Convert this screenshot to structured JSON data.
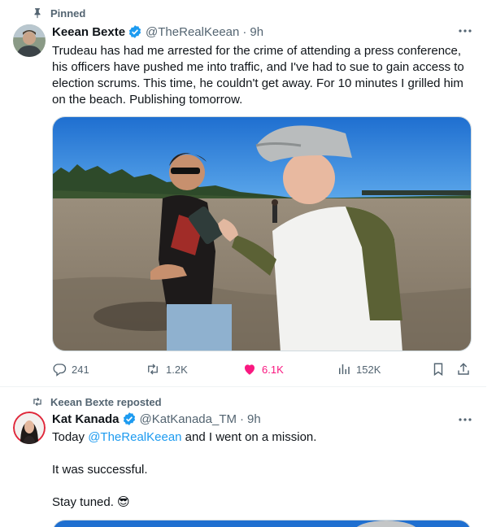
{
  "tweet1": {
    "social_context": "Pinned",
    "author_name": "Keean Bexte",
    "author_handle": "@TheRealKeean",
    "separator": "·",
    "time": "9h",
    "text": "Trudeau has had me arrested for the crime of attending a press conference, his officers have pushed me into traffic, and I've had to sue to gain access to election scrums. This time, he couldn't get away. For 10 minutes I grilled him on the beach. Publishing tomorrow.",
    "metrics": {
      "replies": "241",
      "reposts": "1.2K",
      "likes": "6.1K",
      "views": "152K"
    }
  },
  "tweet2": {
    "social_context": "Keean Bexte reposted",
    "author_name": "Kat Kanada",
    "author_handle": "@KatKanada_TM",
    "separator": "·",
    "time": "9h",
    "line1_before": "Today ",
    "line1_mention": "@TheRealKeean",
    "line1_after": " and I went on a mission.",
    "line2": "It was successful.",
    "line3": "Stay tuned. 😎"
  },
  "colors": {
    "text": "#0f1419",
    "secondary": "#536471",
    "accent": "#1d9bf0",
    "like": "#f91880",
    "divider": "#eff3f4"
  },
  "icons": [
    "pin-icon",
    "verified-icon",
    "more-icon",
    "reply-icon",
    "repost-icon",
    "like-icon",
    "views-icon",
    "bookmark-icon",
    "share-icon"
  ]
}
